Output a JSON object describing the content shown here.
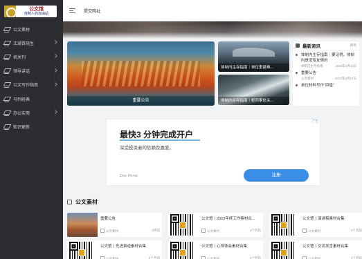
{
  "logo": {
    "title": "公文馆",
    "subtitle": "体制人的加油站"
  },
  "sidebar": {
    "items": [
      {
        "label": "公文素材",
        "has_arrow": false
      },
      {
        "label": "江湖百晓生",
        "has_arrow": true
      },
      {
        "label": "机关刊",
        "has_arrow": true
      },
      {
        "label": "领导讲话",
        "has_arrow": true
      },
      {
        "label": "公文写作指南",
        "has_arrow": true
      },
      {
        "label": "马列经典",
        "has_arrow": false
      },
      {
        "label": "办公实用",
        "has_arrow": true
      },
      {
        "label": "知识更新",
        "has_arrow": false
      }
    ]
  },
  "topbar": {
    "link": "提交网址"
  },
  "featured": {
    "main_caption": "重要公告",
    "small1_caption": "体制内生存指南｜单位里最难...",
    "small2_caption": "体制内生存指南｜柜同事处关..."
  },
  "news": {
    "title": "最新资讯",
    "more": "所有",
    "items": [
      {
        "title": "体制内生存指南｜要记得，体制内是没有友情的",
        "category": "体制内生存指南",
        "date": "2024年3月11日"
      },
      {
        "title": "重要公告",
        "category": "公文素材",
        "date": "2024年2月27日"
      },
      {
        "title": "单位材料写作“四借”",
        "category": "",
        "date": ""
      }
    ]
  },
  "ad": {
    "tag": "广告",
    "headline": "最快3 分钟完成开户",
    "sub": "深受投资者的信赖及喜爱。",
    "brand": "Doo Prime",
    "button": "注册"
  },
  "section": {
    "title": "公文素材"
  },
  "cards": [
    {
      "title": "重要公告",
      "category": "公文素材",
      "time": "2周前",
      "thumb": "photo"
    },
    {
      "title": "公文馆丨2023年终工作素材合...",
      "category": "公文素材",
      "time": "3个月前",
      "thumb": "qr"
    },
    {
      "title": "公文馆丨演讲稿素材合集",
      "category": "公文素材",
      "time": "4个月前",
      "thumb": "qr"
    },
    {
      "title": "公文馆丨先进事迹素材合集",
      "category": "公文素材",
      "time": "4个月前",
      "thumb": "qr"
    },
    {
      "title": "公文馆丨心得体会素材合集",
      "category": "公文素材",
      "time": "4个月前",
      "thumb": "qr"
    },
    {
      "title": "公文馆丨交流发言素材合集",
      "category": "公文素材",
      "time": "4个月前",
      "thumb": "qr"
    }
  ],
  "colors": {
    "sidebar_bg": "#2b2d31",
    "ad_button": "#3a8ee6",
    "logo_accent": "#a32020"
  }
}
